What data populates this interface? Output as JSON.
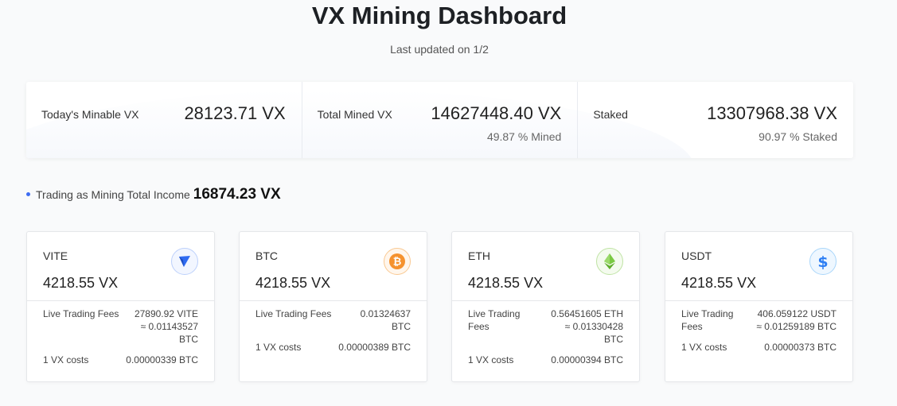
{
  "header": {
    "title": "VX Mining Dashboard",
    "subtitle": "Last updated on 1/2"
  },
  "stats": [
    {
      "label": "Today's Minable VX",
      "value": "28123.71 VX",
      "sub": ""
    },
    {
      "label": "Total Mined VX",
      "value": "14627448.40 VX",
      "sub": "49.87 % Mined"
    },
    {
      "label": "Staked",
      "value": "13307968.38 VX",
      "sub": "90.97 % Staked"
    }
  ],
  "income": {
    "label": "Trading as Mining Total Income",
    "value": "16874.23 VX"
  },
  "cards": [
    {
      "name": "VITE",
      "icon": "vite-icon",
      "color": "#2f6bf1",
      "amount": "4218.55 VX",
      "fee_label": "Live Trading Fees",
      "fee_value": "27890.92 VITE",
      "fee_btc": "≈ 0.01143527 BTC",
      "cost_label": "1 VX costs",
      "cost_value": "0.00000339 BTC"
    },
    {
      "name": "BTC",
      "icon": "bitcoin-icon",
      "color": "#f5922e",
      "amount": "4218.55 VX",
      "fee_label": "Live Trading Fees",
      "fee_value": "0.01324637 BTC",
      "fee_btc": "",
      "cost_label": "1 VX costs",
      "cost_value": "0.00000389 BTC"
    },
    {
      "name": "ETH",
      "icon": "ethereum-icon",
      "color": "#7ac943",
      "amount": "4218.55 VX",
      "fee_label": "Live Trading Fees",
      "fee_value": "0.56451605 ETH",
      "fee_btc": "≈ 0.01330428 BTC",
      "cost_label": "1 VX costs",
      "cost_value": "0.00000394 BTC"
    },
    {
      "name": "USDT",
      "icon": "dollar-icon",
      "color": "#2d9cf4",
      "amount": "4218.55 VX",
      "fee_label": "Live Trading Fees",
      "fee_value": "406.059122 USDT",
      "fee_btc": "≈ 0.01259189 BTC",
      "cost_label": "1 VX costs",
      "cost_value": "0.00000373 BTC"
    }
  ]
}
